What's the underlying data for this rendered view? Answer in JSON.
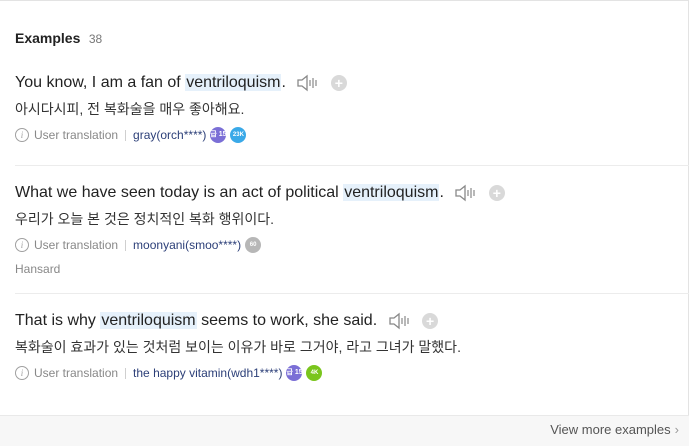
{
  "header": {
    "title": "Examples",
    "count": "38"
  },
  "examples": [
    {
      "before": "You know, I am a fan of ",
      "keyword": "ventriloquism",
      "after": ".",
      "translation": "아시다시피, 전 복화술을 매우 좋아해요.",
      "source": "User translation",
      "user": "gray(orch****)",
      "badges": [
        "급\n15",
        "23K"
      ]
    },
    {
      "before": "What we have seen today is an act of political ",
      "keyword": "ventriloquism",
      "after": ".",
      "translation": "우리가 오늘 본 것은 정치적인 복화 행위이다.",
      "source": "User translation",
      "user": "moonyani(smoo****)",
      "badges": [
        "60"
      ],
      "origin": "Hansard"
    },
    {
      "before": "That is why ",
      "keyword": "ventriloquism",
      "after": " seems to work, she said.",
      "translation": "복화술이 효과가 있는 것처럼 보이는 이유가 바로 그거야, 라고 그녀가 말했다.",
      "source": "User translation",
      "user": "the happy vitamin(wdh1****)",
      "badges": [
        "급\n15",
        "4K"
      ]
    }
  ],
  "footer": {
    "more_label": "View more examples",
    "chevron": "›"
  },
  "icons": {
    "speaker": "speaker-icon",
    "add": "plus-icon",
    "info": "info-icon"
  },
  "colors": {
    "highlight": "#e6f1fb",
    "user_link": "#2c3f78",
    "badge_purple": "#7b6fd6",
    "badge_blue": "#3aa9e8",
    "badge_gray": "#b7b7b7",
    "badge_green": "#7ac51d"
  }
}
